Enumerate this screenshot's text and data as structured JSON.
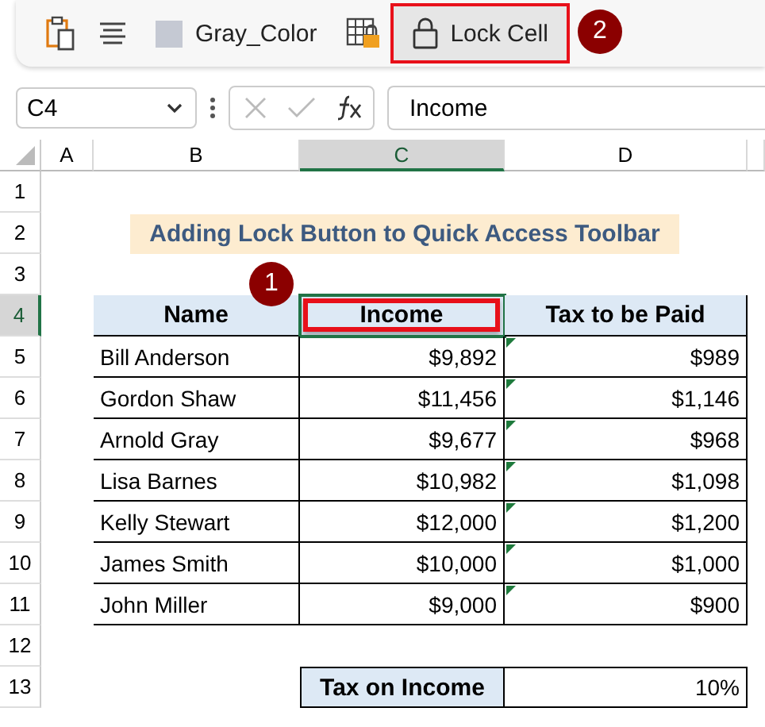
{
  "toolbar": {
    "items": [
      {
        "kind": "paste"
      },
      {
        "kind": "align"
      },
      {
        "kind": "color",
        "label": "Gray_Color",
        "color": "#c5c9d3"
      },
      {
        "kind": "lock-sheet"
      },
      {
        "kind": "lock",
        "label": "Lock Cell",
        "highlighted": true
      }
    ],
    "callout": "2"
  },
  "formula_bar": {
    "name_box": "C4",
    "value": "Income"
  },
  "columns": [
    {
      "label": "A",
      "selected": false
    },
    {
      "label": "B",
      "selected": false
    },
    {
      "label": "C",
      "selected": true
    },
    {
      "label": "D",
      "selected": false
    }
  ],
  "row_headers": [
    {
      "label": "1",
      "selected": false
    },
    {
      "label": "2",
      "selected": false
    },
    {
      "label": "3",
      "selected": false
    },
    {
      "label": "4",
      "selected": true
    },
    {
      "label": "5",
      "selected": false
    },
    {
      "label": "6",
      "selected": false
    },
    {
      "label": "7",
      "selected": false
    },
    {
      "label": "8",
      "selected": false
    },
    {
      "label": "9",
      "selected": false
    },
    {
      "label": "10",
      "selected": false
    },
    {
      "label": "11",
      "selected": false
    },
    {
      "label": "12",
      "selected": false
    },
    {
      "label": "13",
      "selected": false
    }
  ],
  "sheet_title": "Adding Lock Button to Quick Access Toolbar",
  "table": {
    "columns": [
      {
        "label": "Name",
        "highlighted": false
      },
      {
        "label": "Income",
        "highlighted": true
      },
      {
        "label": "Tax to be Paid",
        "highlighted": false
      }
    ],
    "callout": "1",
    "rows": [
      {
        "name": "Bill Anderson",
        "income": "$9,892",
        "tax": "$989",
        "flagged": true
      },
      {
        "name": "Gordon Shaw",
        "income": "$11,456",
        "tax": "$1,146",
        "flagged": true
      },
      {
        "name": "Arnold Gray",
        "income": "$9,677",
        "tax": "$968",
        "flagged": true
      },
      {
        "name": "Lisa Barnes",
        "income": "$10,982",
        "tax": "$1,098",
        "flagged": true
      },
      {
        "name": "Kelly Stewart",
        "income": "$12,000",
        "tax": "$1,200",
        "flagged": true
      },
      {
        "name": "James Smith",
        "income": "$10,000",
        "tax": "$1,000",
        "flagged": true
      },
      {
        "name": "John Miller",
        "income": "$9,000",
        "tax": "$900",
        "flagged": true
      }
    ]
  },
  "summary": {
    "label": "Tax on Income",
    "value": "10%"
  }
}
